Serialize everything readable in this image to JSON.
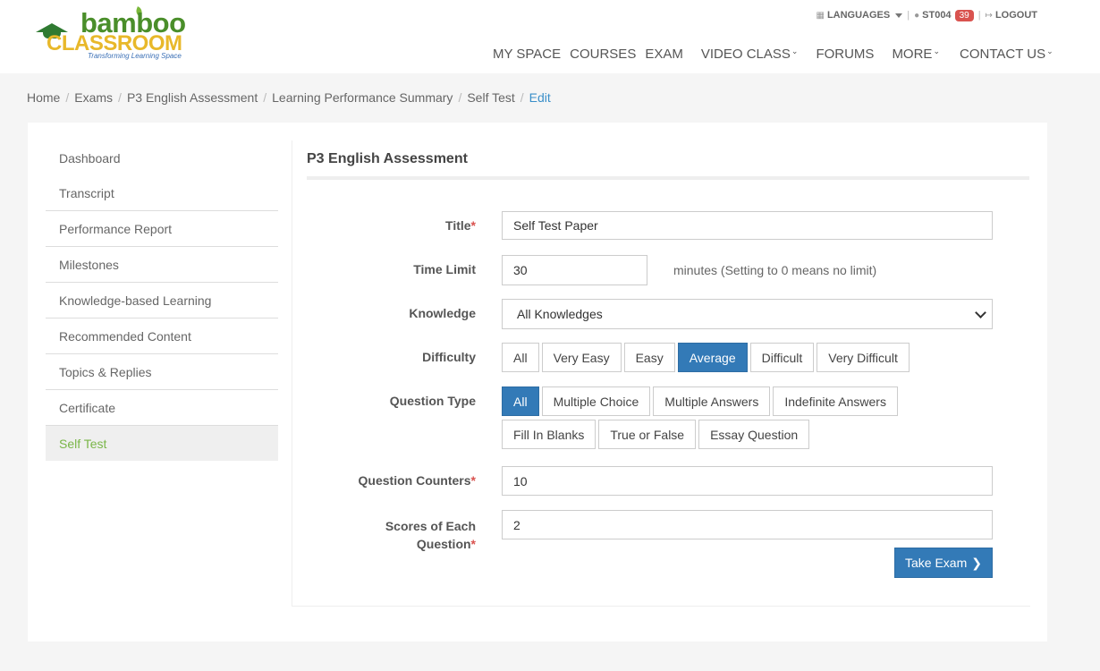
{
  "header": {
    "logo": {
      "brand1": "bamboo",
      "brand2": "CLASSROOM",
      "tagline": "Transforming Learning Space"
    },
    "top_links": {
      "languages": "LANGUAGES",
      "user": "ST004",
      "badge_count": "39",
      "logout": "LOGOUT"
    },
    "nav": [
      "MY SPACE",
      "COURSES",
      "EXAM",
      "VIDEO CLASS",
      "FORUMS",
      "MORE",
      "CONTACT US"
    ]
  },
  "breadcrumb": {
    "items": [
      "Home",
      "Exams",
      "P3 English Assessment",
      "Learning Performance Summary",
      "Self Test"
    ],
    "active": "Edit"
  },
  "sidebar": {
    "items": [
      "Dashboard",
      "Transcript",
      "Performance Report",
      "Milestones",
      "Knowledge-based Learning",
      "Recommended Content",
      "Topics & Replies",
      "Certificate",
      "Self Test"
    ],
    "active_index": 8
  },
  "form": {
    "heading": "P3 English Assessment",
    "title_label": "Title",
    "title_value": "Self Test Paper",
    "time_limit_label": "Time Limit",
    "time_limit_value": "30",
    "time_limit_hint": "minutes (Setting to 0 means no limit)",
    "knowledge_label": "Knowledge",
    "knowledge_value": "All Knowledges",
    "difficulty_label": "Difficulty",
    "difficulty_options": [
      "All",
      "Very Easy",
      "Easy",
      "Average",
      "Difficult",
      "Very Difficult"
    ],
    "difficulty_selected": "Average",
    "question_type_label": "Question Type",
    "question_type_row1": [
      "All",
      "Multiple Choice",
      "Multiple Answers",
      "Indefinite Answers"
    ],
    "question_type_row2": [
      "Fill In Blanks",
      "True or False",
      "Essay Question"
    ],
    "question_type_selected": "All",
    "counters_label": "Question Counters",
    "counters_value": "10",
    "scores_label_line1": "Scores of Each",
    "scores_label_line2": "Question",
    "scores_value": "2",
    "submit_label": "Take Exam"
  },
  "colors": {
    "accent": "#337ab7",
    "active_side": "#7ab648",
    "required": "#d9534f"
  }
}
